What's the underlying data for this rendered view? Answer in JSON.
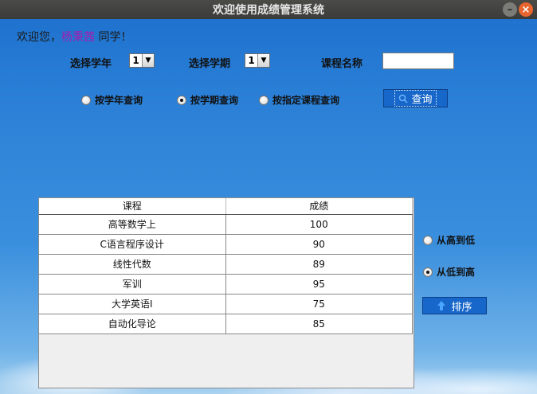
{
  "window": {
    "title": "欢迎使用成绩管理系统",
    "minimize_glyph": "–",
    "close_glyph": "×"
  },
  "welcome": {
    "prefix": "欢迎您，",
    "user": "杨秉茜",
    "suffix": " 同学！"
  },
  "filters": {
    "year_label": "选择学年",
    "year_value": "1",
    "term_label": "选择学期",
    "term_value": "1",
    "course_label": "课程名称",
    "course_value": ""
  },
  "query_modes": [
    {
      "label": "按学年查询",
      "selected": false
    },
    {
      "label": "按学期查询",
      "selected": true
    },
    {
      "label": "按指定课程查询",
      "selected": false
    }
  ],
  "query_button": {
    "label": "查询",
    "icon": "search-icon"
  },
  "table": {
    "headers": [
      "课程",
      "成绩"
    ],
    "rows": [
      [
        "高等数学上",
        "100"
      ],
      [
        "C语言程序设计",
        "90"
      ],
      [
        "线性代数",
        "89"
      ],
      [
        "军训",
        "95"
      ],
      [
        "大学英语I",
        "75"
      ],
      [
        "自动化导论",
        "85"
      ]
    ]
  },
  "sort_options": [
    {
      "label": "从高到低",
      "selected": false
    },
    {
      "label": "从低到高",
      "selected": true
    }
  ],
  "sort_button": {
    "label": "排序",
    "icon": "up-arrow-icon"
  },
  "colors": {
    "accent": "#1766c9",
    "user_name": "#a11fb0"
  }
}
